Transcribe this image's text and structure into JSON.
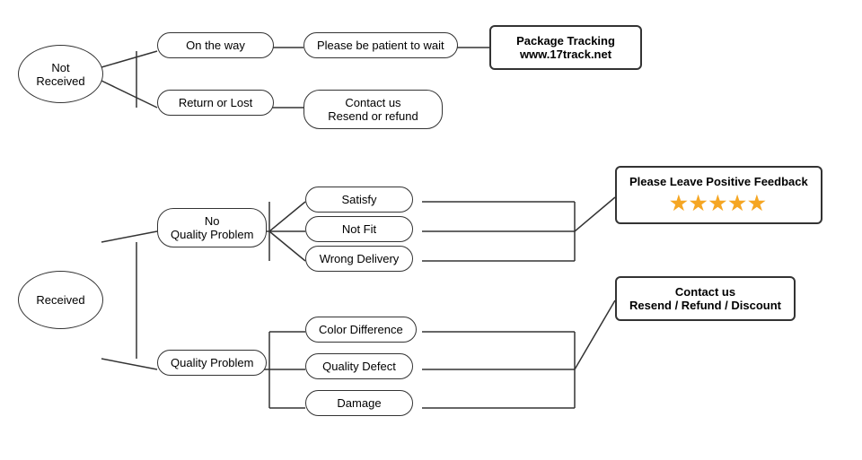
{
  "nodes": {
    "not_received": "Not\nReceived",
    "received": "Received",
    "on_the_way": "On the way",
    "return_or_lost": "Return or Lost",
    "be_patient": "Please be patient to wait",
    "contact_resend_refund": "Contact us\nResend or refund",
    "package_tracking": "Package Tracking\nwww.17track.net",
    "no_quality_problem": "No\nQuality Problem",
    "quality_problem": "Quality Problem",
    "satisfy": "Satisfy",
    "not_fit": "Not Fit",
    "wrong_delivery": "Wrong Delivery",
    "color_difference": "Color Difference",
    "quality_defect": "Quality Defect",
    "damage": "Damage",
    "please_leave_feedback": "Please Leave Positive Feedback",
    "contact_resend_refund_discount": "Contact us\nResend / Refund / Discount"
  },
  "stars": "★★★★★",
  "colors": {
    "star": "#f5a623",
    "border": "#333"
  }
}
